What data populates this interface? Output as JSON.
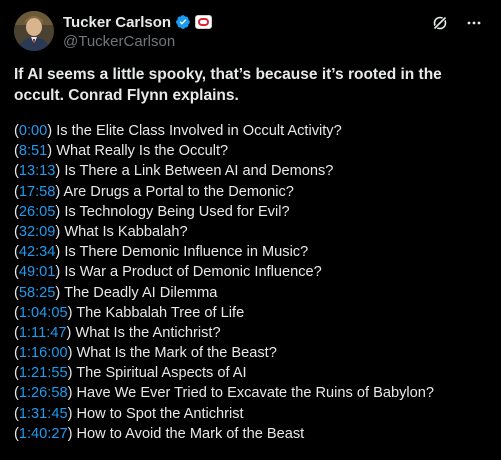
{
  "author": {
    "display_name": "Tucker Carlson",
    "handle": "@TuckerCarlson",
    "avatar": "avatar-photo",
    "verified_icon": "verified-check-icon",
    "affiliate_badge": "affiliate-badge-icon"
  },
  "actions": {
    "grok_icon": "grok-icon",
    "more_icon": "more-icon"
  },
  "tweet": {
    "headline": "If AI seems a little spooky, that’s because it’s rooted in the occult. Conrad Flynn explains."
  },
  "chapters": [
    {
      "open": "(",
      "time": "0:00",
      "close": ")",
      "title": " Is the Elite Class Involved in Occult Activity?"
    },
    {
      "open": "(",
      "time": "8:51",
      "close": ")",
      "title": " What Really Is the Occult?"
    },
    {
      "open": "(",
      "time": "13:13",
      "close": ")",
      "title": " Is There a Link Between AI and Demons?"
    },
    {
      "open": "(",
      "time": "17:58",
      "close": ")",
      "title": " Are Drugs a Portal to the Demonic?"
    },
    {
      "open": "(",
      "time": "26:05",
      "close": ")",
      "title": " Is Technology Being Used for Evil?"
    },
    {
      "open": "(",
      "time": "32:09",
      "close": ")",
      "title": " What Is Kabbalah?"
    },
    {
      "open": "(",
      "time": "42:34",
      "close": ")",
      "title": " Is There Demonic Influence in Music?"
    },
    {
      "open": "(",
      "time": "49:01",
      "close": ")",
      "title": " Is War a Product of Demonic Influence?"
    },
    {
      "open": "(",
      "time": "58:25",
      "close": ")",
      "title": " The Deadly AI Dilemma"
    },
    {
      "open": "(",
      "time": "1:04:05",
      "close": ")",
      "title": " The Kabbalah Tree of Life"
    },
    {
      "open": "(",
      "time": "1:11:47",
      "close": ")",
      "title": " What Is the Antichrist?"
    },
    {
      "open": "(",
      "time": "1:16:00",
      "close": ")",
      "title": " What Is the Mark of the Beast?"
    },
    {
      "open": "(",
      "time": "1:21:55",
      "close": ")",
      "title": " The Spiritual Aspects of AI"
    },
    {
      "open": "(",
      "time": "1:26:58",
      "close": ")",
      "title": " Have We Ever Tried to Excavate the Ruins of Babylon?"
    },
    {
      "open": "(",
      "time": "1:31:45",
      "close": ")",
      "title": " How to Spot the Antichrist"
    },
    {
      "open": "(",
      "time": "1:40:27",
      "close": ")",
      "title": " How to Avoid the Mark of the Beast"
    }
  ],
  "colors": {
    "background": "#000000",
    "text": "#e7e9ea",
    "secondary_text": "#71767b",
    "link": "#1d9bf0",
    "verified": "#1d9bf0",
    "affiliate_badge": "#e0232e"
  }
}
